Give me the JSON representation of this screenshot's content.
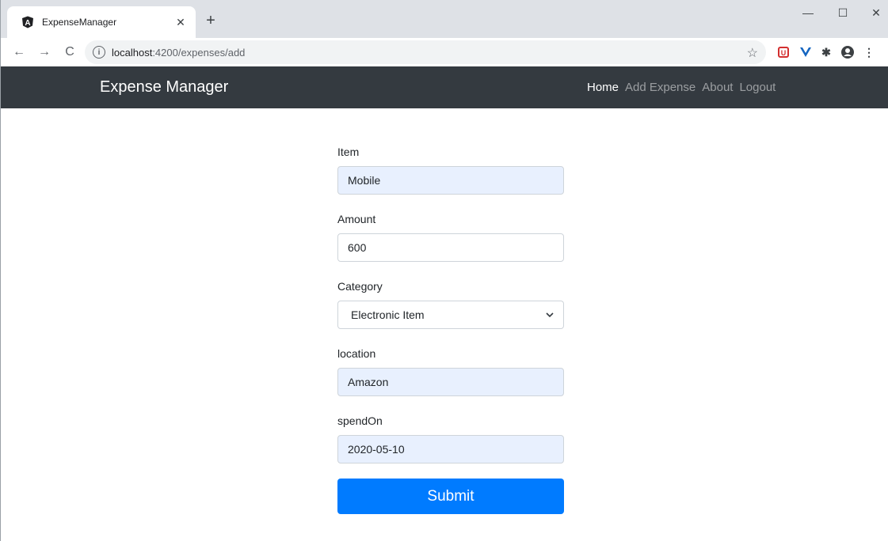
{
  "browser": {
    "tab_title": "ExpenseManager",
    "url_host": "localhost",
    "url_path": ":4200/expenses/add"
  },
  "navbar": {
    "brand": "Expense Manager",
    "links": [
      {
        "label": "Home",
        "active": true
      },
      {
        "label": "Add Expense",
        "active": false
      },
      {
        "label": "About",
        "active": false
      },
      {
        "label": "Logout",
        "active": false
      }
    ]
  },
  "form": {
    "item_label": "Item",
    "item_value": "Mobile",
    "amount_label": "Amount",
    "amount_value": "600",
    "category_label": "Category",
    "category_value": "Electronic Item",
    "location_label": "location",
    "location_value": "Amazon",
    "spendon_label": "spendOn",
    "spendon_value": "2020-05-10",
    "submit_label": "Submit"
  },
  "colors": {
    "navbar_bg": "#343a40",
    "primary": "#007bff",
    "autofill_bg": "#e8f0fe"
  },
  "icons": [
    "angular-icon",
    "close-icon",
    "plus-icon",
    "back-icon",
    "forward-icon",
    "reload-icon",
    "info-icon",
    "star-icon",
    "ublock-icon",
    "vue-icon",
    "puzzle-icon",
    "account-icon",
    "menu-icon",
    "chevron-down-icon"
  ]
}
